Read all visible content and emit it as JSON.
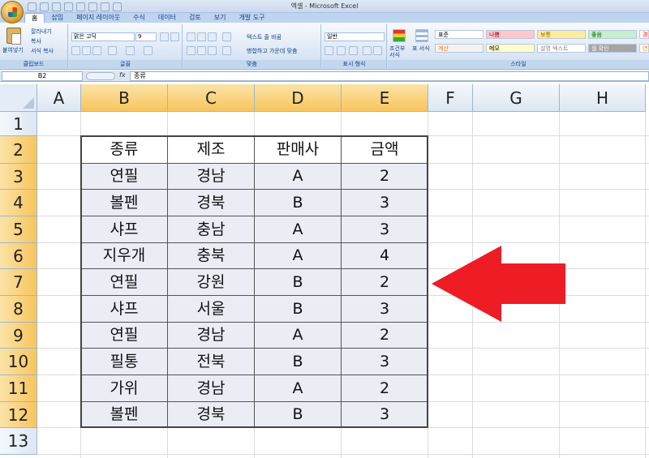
{
  "window": {
    "title": "엑셀 - Microsoft Excel"
  },
  "tabs": [
    "홈",
    "삽입",
    "페이지 레이아웃",
    "수식",
    "데이터",
    "검토",
    "보기",
    "개발 도구"
  ],
  "ribbon": {
    "clipboard": {
      "paste_label": "붙여넣기",
      "cut_label": "잘라내기",
      "copy_label": "복사",
      "format_painter_label": "서식 복사",
      "group_label": "클립보드"
    },
    "font": {
      "font_name": "맑은 고딕",
      "font_size": "9",
      "group_label": "글꼴"
    },
    "alignment": {
      "wrap_text_label": "텍스트 줄 바꿈",
      "merge_label": "병합하고 가운데 맞춤",
      "group_label": "맞춤"
    },
    "number": {
      "format_value": "일반",
      "group_label": "표시 형식"
    },
    "styles": {
      "conditional_label": "조건부 서식",
      "table_label": "표 서식",
      "group_label": "스타일",
      "cells": [
        {
          "label": "표준",
          "bg": "#ffffff",
          "fg": "#000000"
        },
        {
          "label": "나쁨",
          "bg": "#ffc7ce",
          "fg": "#9c0006"
        },
        {
          "label": "보통",
          "bg": "#ffeb9c",
          "fg": "#9c6500"
        },
        {
          "label": "좋음",
          "bg": "#c6efce",
          "fg": "#006100"
        },
        {
          "label": "경고문",
          "bg": "#ffffff",
          "fg": "#ff0000"
        },
        {
          "label": "계산",
          "bg": "#f2f2f2",
          "fg": "#fa7d00"
        },
        {
          "label": "메모",
          "bg": "#ffffcc",
          "fg": "#000000"
        },
        {
          "label": "설명 텍스트",
          "bg": "#ffffff",
          "fg": "#7f7f7f"
        },
        {
          "label": "셀 확인",
          "bg": "#a5a5a5",
          "fg": "#ffffff"
        },
        {
          "label": "연결된",
          "bg": "#ffffff",
          "fg": "#fa7d00"
        }
      ]
    }
  },
  "formula_bar": {
    "cell_ref": "B2",
    "fx": "fx",
    "content": "종류"
  },
  "grid": {
    "columns": [
      "A",
      "B",
      "C",
      "D",
      "E",
      "F",
      "G",
      "H"
    ],
    "selected_columns": [
      "B",
      "C",
      "D",
      "E"
    ],
    "rows": [
      "1",
      "2",
      "3",
      "4",
      "5",
      "6",
      "7",
      "8",
      "9",
      "10",
      "11",
      "12",
      "13"
    ],
    "selected_rows": [
      "2",
      "3",
      "4",
      "5",
      "6",
      "7",
      "8",
      "9",
      "10",
      "11",
      "12"
    ]
  },
  "table": {
    "headers": [
      "종류",
      "제조",
      "판매사",
      "금액"
    ],
    "rows": [
      [
        "연필",
        "경남",
        "A",
        "2"
      ],
      [
        "볼펜",
        "경북",
        "B",
        "3"
      ],
      [
        "샤프",
        "충남",
        "A",
        "3"
      ],
      [
        "지우개",
        "충북",
        "A",
        "4"
      ],
      [
        "연필",
        "강원",
        "B",
        "2"
      ],
      [
        "샤프",
        "서울",
        "B",
        "3"
      ],
      [
        "연필",
        "경남",
        "A",
        "2"
      ],
      [
        "필통",
        "전북",
        "B",
        "3"
      ],
      [
        "가위",
        "경남",
        "A",
        "2"
      ],
      [
        "볼펜",
        "경북",
        "B",
        "3"
      ]
    ]
  },
  "annotation": {
    "arrow_color": "#ee1c25"
  }
}
